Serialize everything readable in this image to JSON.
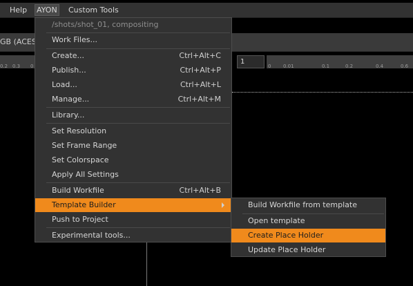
{
  "menubar": {
    "items": [
      {
        "label": "Help"
      },
      {
        "label": "AYON"
      },
      {
        "label": "Custom Tools"
      }
    ]
  },
  "toolbar": {
    "colorspace": "GB (ACES",
    "frame_value": "1"
  },
  "ruler_left": {
    "ticks": [
      "0.2",
      "0.3",
      "0"
    ]
  },
  "ruler_right": {
    "ticks": [
      "0",
      "0.01",
      "0.1",
      "0.2",
      "0.4",
      "0.6"
    ]
  },
  "ayon_menu": {
    "context": "/shots/shot_01, compositing",
    "items": [
      {
        "label": "Work Files...",
        "shortcut": ""
      },
      {
        "label": "Create...",
        "shortcut": "Ctrl+Alt+C"
      },
      {
        "label": "Publish...",
        "shortcut": "Ctrl+Alt+P"
      },
      {
        "label": "Load...",
        "shortcut": "Ctrl+Alt+L"
      },
      {
        "label": "Manage...",
        "shortcut": "Ctrl+Alt+M"
      },
      {
        "label": "Library...",
        "shortcut": ""
      },
      {
        "label": "Set Resolution",
        "shortcut": ""
      },
      {
        "label": "Set Frame Range",
        "shortcut": ""
      },
      {
        "label": "Set Colorspace",
        "shortcut": ""
      },
      {
        "label": "Apply All Settings",
        "shortcut": ""
      },
      {
        "label": "Build Workfile",
        "shortcut": "Ctrl+Alt+B"
      },
      {
        "label": "Template Builder",
        "shortcut": ""
      },
      {
        "label": "Push to Project",
        "shortcut": ""
      },
      {
        "label": "Experimental tools...",
        "shortcut": ""
      }
    ]
  },
  "template_builder_menu": {
    "items": [
      {
        "label": "Build Workfile from template"
      },
      {
        "label": "Open template"
      },
      {
        "label": "Create Place Holder"
      },
      {
        "label": "Update Place Holder"
      }
    ]
  },
  "colors": {
    "highlight": "#f08a1c",
    "menu_bg": "#323232"
  }
}
